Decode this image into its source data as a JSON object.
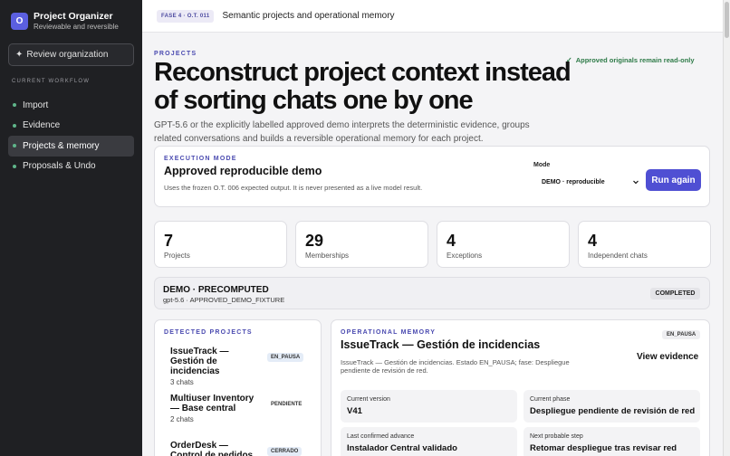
{
  "brand": {
    "logo_letter": "O",
    "title": "Project Organizer",
    "subtitle": "Reviewable and reversible"
  },
  "sidebar": {
    "review_button": "Review organization",
    "workflow_heading": "CURRENT WORKFLOW",
    "items": [
      {
        "label": "Import",
        "active": false
      },
      {
        "label": "Evidence",
        "active": false
      },
      {
        "label": "Projects & memory",
        "active": true
      },
      {
        "label": "Proposals & Undo",
        "active": false
      }
    ]
  },
  "topbar": {
    "phase": "FASE 4 · O.T. 011",
    "title": "Semantic projects and operational memory"
  },
  "page": {
    "section": "PROJECTS",
    "readonly_notice": "Approved originals remain read-only",
    "heading": "Reconstruct project context instead of sorting chats one by one",
    "lead": "GPT-5.6 or the explicitly labelled approved demo interprets the deterministic evidence, groups related conversations and builds a reversible operational memory for each project."
  },
  "execution": {
    "label": "EXECUTION MODE",
    "title": "Approved reproducible demo",
    "description": "Uses the frozen O.T. 006 expected output. It is never presented as a live model result.",
    "mode_label": "Mode",
    "mode_value": "DEMO · reproducible",
    "run_button": "Run again"
  },
  "stats": [
    {
      "value": "7",
      "label": "Projects"
    },
    {
      "value": "29",
      "label": "Memberships"
    },
    {
      "value": "4",
      "label": "Exceptions"
    },
    {
      "value": "4",
      "label": "Independent chats"
    }
  ],
  "run_status": {
    "title": "DEMO · PRECOMPUTED",
    "subtitle": "gpt-5.6 · APPROVED_DEMO_FIXTURE",
    "badge": "COMPLETED"
  },
  "detected": {
    "label": "DETECTED PROJECTS",
    "projects": [
      {
        "name": "IssueTrack — Gestión de incidencias",
        "chats": "3 chats",
        "status": "EN_PAUSA",
        "badge_color": "#e4ecf7"
      },
      {
        "name": "Multiuser Inventory — Base central",
        "chats": "2 chats",
        "status": "PENDIENTE",
        "badge_color": "#ffffff"
      },
      {
        "name": "OrderDesk — Control de pedidos",
        "chats": "",
        "status": "CERRADO",
        "badge_color": "#e4ecf7"
      }
    ]
  },
  "memory": {
    "label": "OPERATIONAL MEMORY",
    "title": "IssueTrack — Gestión de incidencias",
    "badge": "EN_PAUSA",
    "view_evidence": "View evidence",
    "description": "IssueTrack — Gestión de incidencias. Estado EN_PAUSA; fase: Despliegue pendiente de revisión de red.",
    "cells": [
      {
        "label": "Current version",
        "value": "V41"
      },
      {
        "label": "Current phase",
        "value": "Despliegue pendiente de revisión de red"
      },
      {
        "label": "Last confirmed advance",
        "value": "Instalador Central validado"
      },
      {
        "label": "Next probable step",
        "value": "Retomar despliegue tras revisar red"
      }
    ]
  },
  "colors": {
    "accent": "#4f4fd3",
    "sidebar_bg": "#1f2023",
    "success": "#2d7a47"
  }
}
